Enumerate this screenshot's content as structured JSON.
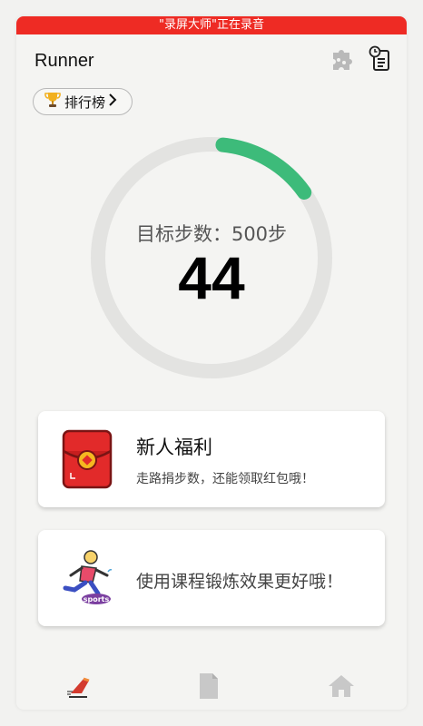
{
  "status": {
    "recording_text": "\"录屏大师\"正在录音"
  },
  "header": {
    "title": "Runner",
    "icons": [
      "puzzle-icon",
      "history-icon"
    ]
  },
  "leaderboard": {
    "label": "排行榜",
    "icon": "trophy-icon",
    "chevron": "chevron-right-icon"
  },
  "progress": {
    "label": "目标步数：500步",
    "steps": "44",
    "goal": 500,
    "fraction": 0.088,
    "ring_color": "#3dbb7a",
    "track_color": "#e3e3e1"
  },
  "cards": [
    {
      "title": "新人福利",
      "subtitle": "走路捐步数，还能领取红包哦！",
      "icon": "red-envelope-icon"
    },
    {
      "title": "使用课程锻炼效果更好哦！",
      "icon": "running-sports-icon",
      "badge": "sports"
    }
  ],
  "nav": [
    "running-shoe-icon",
    "document-icon",
    "home-icon"
  ],
  "colors": {
    "accent": "#3dbb7a",
    "record_bar": "#ee2b24",
    "envelope": "#e22a2a"
  }
}
